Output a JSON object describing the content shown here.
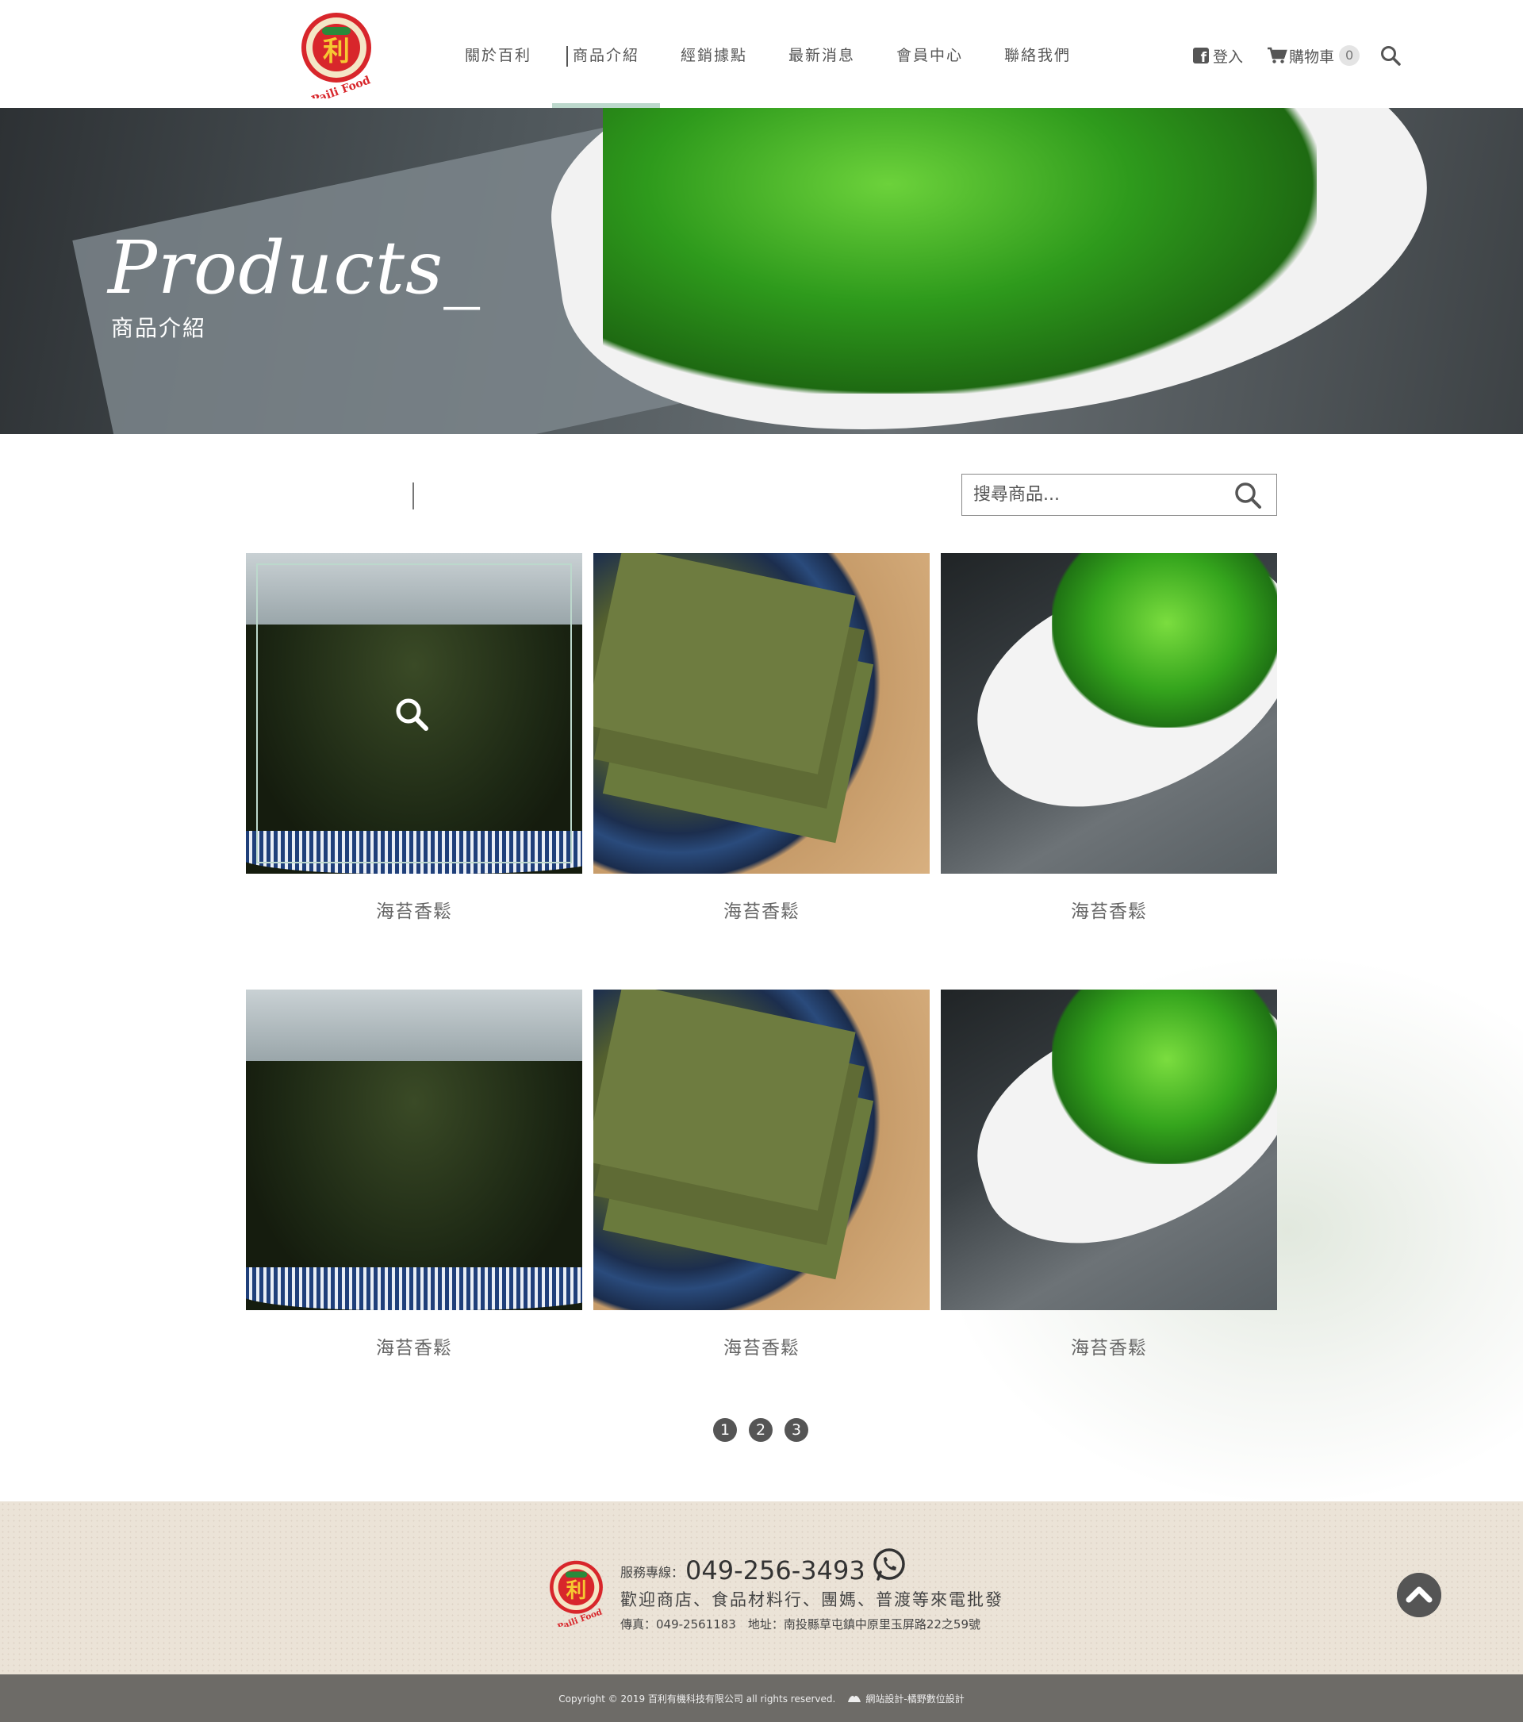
{
  "brand": {
    "logo_text": "Paili Food",
    "logo_char": "利"
  },
  "nav": {
    "items": [
      {
        "label": "關於百利",
        "active": false
      },
      {
        "label": "商品介紹",
        "active": true
      },
      {
        "label": "經銷據點",
        "active": false
      },
      {
        "label": "最新消息",
        "active": false
      },
      {
        "label": "會員中心",
        "active": false
      },
      {
        "label": "聯絡我們",
        "active": false
      }
    ],
    "login_label": "登入",
    "cart_label": "購物車",
    "cart_count": "0",
    "active_underline_color": "#bcd8cc"
  },
  "banner": {
    "title": "Products_",
    "subtitle": "商品介紹"
  },
  "filter": {
    "search_placeholder": "搜尋商品..."
  },
  "products": [
    {
      "name": "海苔香鬆",
      "image": "laver-flakes-bowl",
      "hovered": true
    },
    {
      "name": "海苔香鬆",
      "image": "laver-sheets-plate",
      "hovered": false
    },
    {
      "name": "海苔香鬆",
      "image": "seaweed-salad-spoon",
      "hovered": false
    },
    {
      "name": "海苔香鬆",
      "image": "laver-flakes-bowl",
      "hovered": false
    },
    {
      "name": "海苔香鬆",
      "image": "laver-sheets-plate",
      "hovered": false
    },
    {
      "name": "海苔香鬆",
      "image": "seaweed-salad-spoon",
      "hovered": false
    }
  ],
  "pagination": {
    "pages": [
      "1",
      "2",
      "3"
    ]
  },
  "footer": {
    "hotline_label": "服務專線：",
    "hotline_number": "049-256-3493",
    "welcome": "歡迎商店、食品材料行、團媽、普渡等來電批發",
    "fax_address": "傳真：049-2561183　地址：南投縣草屯鎮中原里玉屏路22之59號",
    "copyright": "Copyright © 2019 百利有機科技有限公司 all rights reserved.",
    "designer": "網站設計-橘野數位設計"
  },
  "icons": [
    "facebook-icon",
    "cart-icon",
    "search-icon",
    "phone-icon",
    "back-to-top-icon"
  ]
}
